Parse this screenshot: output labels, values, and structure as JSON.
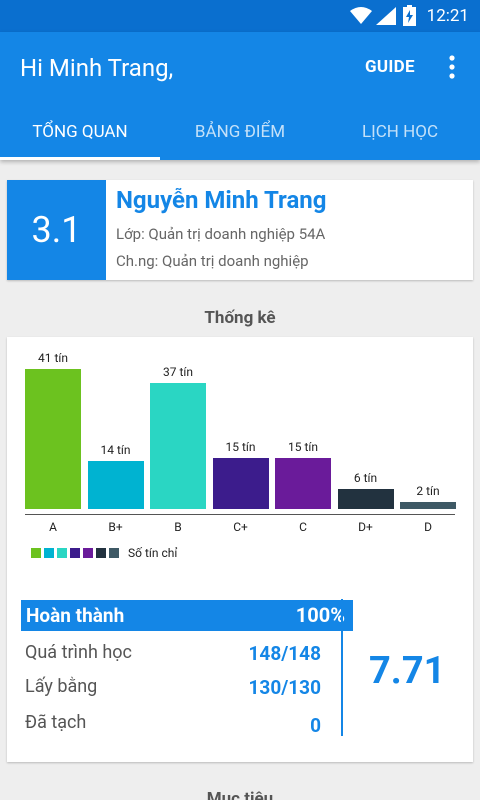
{
  "status_bar": {
    "time": "12:21",
    "icons": [
      "wifi-icon",
      "signal-icon",
      "battery-charging-icon"
    ]
  },
  "app_bar": {
    "title": "Hi Minh Trang,",
    "guide_label": "GUIDE",
    "overflow_icon": "more-vert-icon"
  },
  "tabs": [
    {
      "label": "TỔNG QUAN",
      "active": true
    },
    {
      "label": "BẢNG ĐIỂM",
      "active": false
    },
    {
      "label": "LỊCH HỌC",
      "active": false
    }
  ],
  "profile": {
    "gpa": "3.1",
    "name": "Nguyễn Minh Trang",
    "class_line": "Lớp: Quản trị doanh nghiệp 54A",
    "major_line": "Ch.ng: Quản trị doanh nghiệp"
  },
  "stats_title": "Thống kê",
  "chart_data": {
    "type": "bar",
    "categories": [
      "A",
      "B+",
      "B",
      "C+",
      "C",
      "D+",
      "D"
    ],
    "values": [
      41,
      14,
      37,
      15,
      15,
      6,
      2
    ],
    "value_labels": [
      "41 tín",
      "14 tín",
      "37 tín",
      "15 tín",
      "15 tín",
      "6 tín",
      "2 tín"
    ],
    "colors": [
      "#6cc21f",
      "#00b3d1",
      "#2ad6c3",
      "#3c1c8c",
      "#6a1b9a",
      "#22323f",
      "#3e5965"
    ],
    "legend_label": "Số tín chỉ",
    "ylim": [
      0,
      41
    ]
  },
  "progress": {
    "done_label": "Hoàn thành",
    "done_value": "100%",
    "rows": [
      {
        "label": "Quá trình học",
        "value": "148/148"
      },
      {
        "label": "Lấy bằng",
        "value": "130/130"
      },
      {
        "label": "Đã tạch",
        "value": "0"
      }
    ],
    "overall_gpa": "7.71"
  },
  "next_section_title": "Mục tiêu"
}
